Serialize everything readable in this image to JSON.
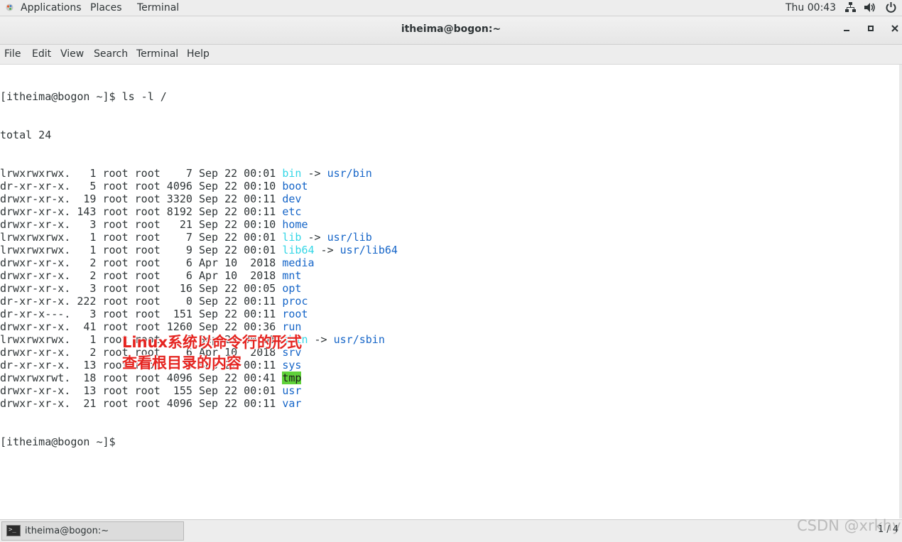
{
  "top_bar": {
    "applications": "Applications",
    "places": "Places",
    "terminal": "Terminal",
    "clock": "Thu 00:43",
    "icons": [
      "network-icon",
      "volume-icon",
      "power-icon"
    ]
  },
  "window": {
    "title": "itheima@bogon:~",
    "buttons": [
      "minimize",
      "maximize",
      "close"
    ]
  },
  "menubar": [
    "File",
    "Edit",
    "View",
    "Search",
    "Terminal",
    "Help"
  ],
  "terminal": {
    "prompt_command": "[itheima@bogon ~]$ ls -l /",
    "total": "total 24",
    "entries": [
      {
        "meta": "lrwxrwxrwx.   1 root root    7 Sep 22 00:01 ",
        "name": "bin",
        "style": "cyan",
        "arrow": " -> ",
        "target": "usr/bin"
      },
      {
        "meta": "dr-xr-xr-x.   5 root root 4096 Sep 22 00:10 ",
        "name": "boot",
        "style": "blue"
      },
      {
        "meta": "drwxr-xr-x.  19 root root 3320 Sep 22 00:11 ",
        "name": "dev",
        "style": "blue"
      },
      {
        "meta": "drwxr-xr-x. 143 root root 8192 Sep 22 00:11 ",
        "name": "etc",
        "style": "blue"
      },
      {
        "meta": "drwxr-xr-x.   3 root root   21 Sep 22 00:10 ",
        "name": "home",
        "style": "blue"
      },
      {
        "meta": "lrwxrwxrwx.   1 root root    7 Sep 22 00:01 ",
        "name": "lib",
        "style": "cyan",
        "arrow": " -> ",
        "target": "usr/lib"
      },
      {
        "meta": "lrwxrwxrwx.   1 root root    9 Sep 22 00:01 ",
        "name": "lib64",
        "style": "cyan",
        "arrow": " -> ",
        "target": "usr/lib64"
      },
      {
        "meta": "drwxr-xr-x.   2 root root    6 Apr 10  2018 ",
        "name": "media",
        "style": "blue"
      },
      {
        "meta": "drwxr-xr-x.   2 root root    6 Apr 10  2018 ",
        "name": "mnt",
        "style": "blue"
      },
      {
        "meta": "drwxr-xr-x.   3 root root   16 Sep 22 00:05 ",
        "name": "opt",
        "style": "blue"
      },
      {
        "meta": "dr-xr-xr-x. 222 root root    0 Sep 22 00:11 ",
        "name": "proc",
        "style": "blue"
      },
      {
        "meta": "dr-xr-x---.   3 root root  151 Sep 22 00:11 ",
        "name": "root",
        "style": "blue"
      },
      {
        "meta": "drwxr-xr-x.  41 root root 1260 Sep 22 00:36 ",
        "name": "run",
        "style": "blue"
      },
      {
        "meta": "lrwxrwxrwx.   1 root root    8 Sep 22 00:01 ",
        "name": "sbin",
        "style": "cyan",
        "arrow": " -> ",
        "target": "usr/sbin"
      },
      {
        "meta": "drwxr-xr-x.   2 root root    6 Apr 10  2018 ",
        "name": "srv",
        "style": "blue"
      },
      {
        "meta": "dr-xr-xr-x.  13 root root    0 Sep 22 00:11 ",
        "name": "sys",
        "style": "blue"
      },
      {
        "meta": "drwxrwxrwt.  18 root root 4096 Sep 22 00:41 ",
        "name": "tmp",
        "style": "tmp"
      },
      {
        "meta": "drwxr-xr-x.  13 root root  155 Sep 22 00:01 ",
        "name": "usr",
        "style": "blue"
      },
      {
        "meta": "drwxr-xr-x.  21 root root 4096 Sep 22 00:11 ",
        "name": "var",
        "style": "blue"
      }
    ],
    "final_prompt": "[itheima@bogon ~]$ "
  },
  "annotation": {
    "line1": "Linux系统以命令行的形式",
    "line2": "查看根目录的内容"
  },
  "taskbar": {
    "item_label": "itheima@bogon:~",
    "workspace": "1 / 4",
    "watermark": "CSDN @xrkhy"
  },
  "colors": {
    "dir": "#1565c8",
    "symlink": "#33d6e6",
    "sticky_bg": "#5fd13a",
    "annotation": "#e52420"
  }
}
